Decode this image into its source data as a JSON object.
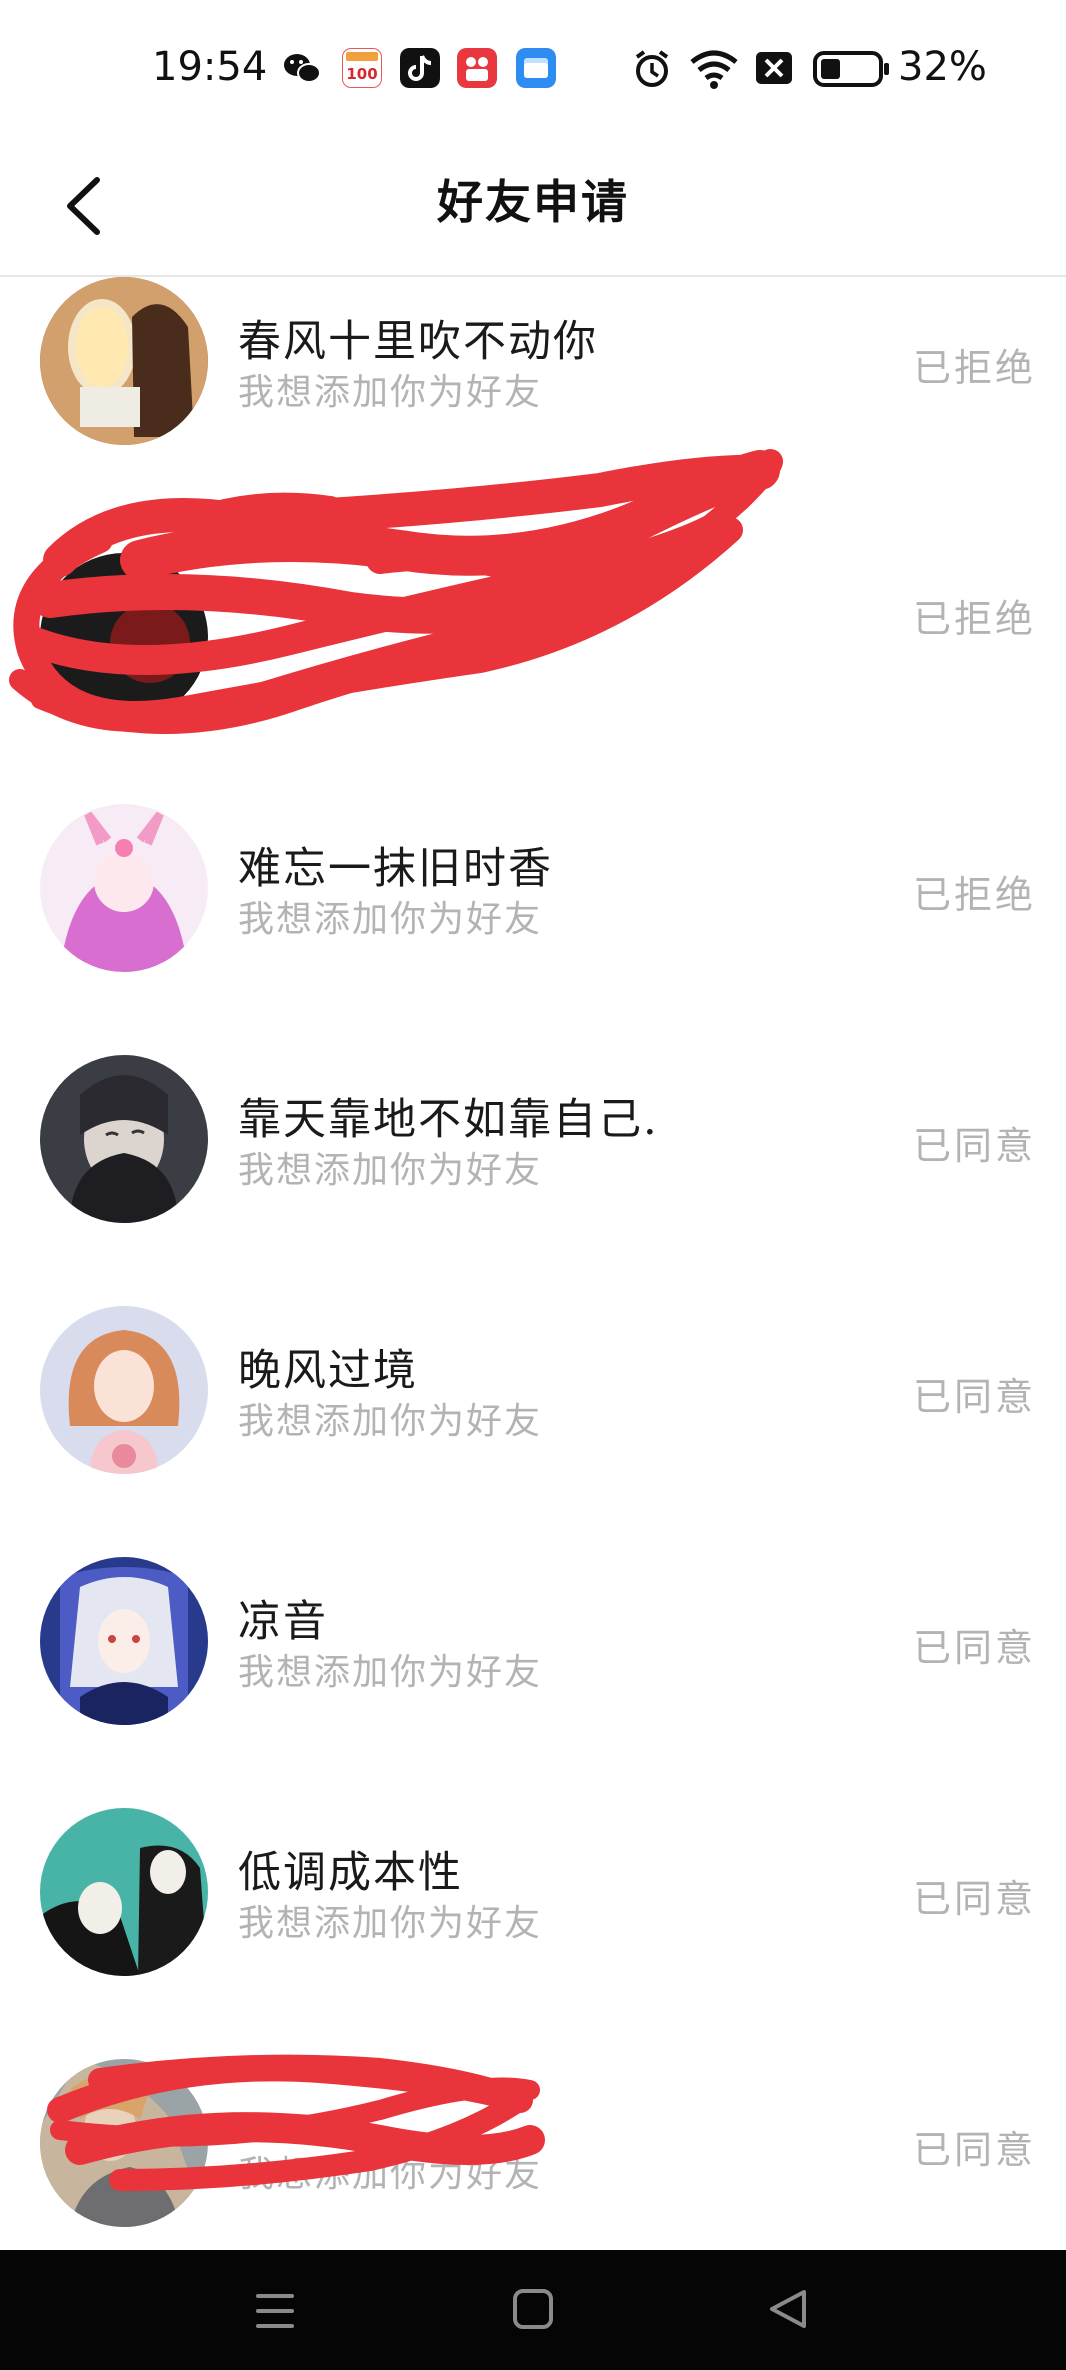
{
  "status_bar": {
    "time": "19:54",
    "battery_percent": "32%",
    "battery_level": 0.32,
    "app_icons": [
      "wechat-icon",
      "xiaoyuan-100-icon",
      "tiktok-icon",
      "kuaishou-icon",
      "files-icon"
    ],
    "system_icons": [
      "alarm-icon",
      "wifi-icon",
      "no-sim-icon",
      "battery-icon"
    ]
  },
  "header": {
    "title": "好友申请",
    "back_icon": "chevron-left-icon"
  },
  "requests": [
    {
      "name": "春风十里吹不动你",
      "message": "我想添加你为好友",
      "status": "已拒绝",
      "avatar_colors": [
        "#d9b38c",
        "#5b3a28"
      ]
    },
    {
      "name": "",
      "message": "",
      "status": "已拒绝",
      "avatar_colors": [
        "#1b1b1b",
        "#7a1a1a"
      ]
    },
    {
      "name": "难忘一抹旧时香",
      "message": "我想添加你为好友",
      "status": "已拒绝",
      "avatar_colors": [
        "#f5d4ec",
        "#c06bc4"
      ]
    },
    {
      "name": "靠天靠地不如靠自己.",
      "message": "我想添加你为好友",
      "status": "已同意",
      "avatar_colors": [
        "#3a3d44",
        "#d9d2cc"
      ]
    },
    {
      "name": "晚风过境",
      "message": "我想添加你为好友",
      "status": "已同意",
      "avatar_colors": [
        "#d9dced",
        "#d98a5a"
      ]
    },
    {
      "name": "凉音",
      "message": "我想添加你为好友",
      "status": "已同意",
      "avatar_colors": [
        "#3a44a8",
        "#e4e6f2"
      ]
    },
    {
      "name": "低调成本性",
      "message": "我想添加你为好友",
      "status": "已同意",
      "avatar_colors": [
        "#48b4a8",
        "#1a1a1a"
      ]
    },
    {
      "name": "",
      "message": "我想添加你为好友",
      "status": "已同意",
      "avatar_colors": [
        "#9aa3a6",
        "#d9a36a"
      ]
    }
  ],
  "system_nav": {
    "icons": [
      "menu-icon",
      "home-icon",
      "back-triangle-icon"
    ]
  },
  "colors": {
    "redaction": "#e8343a",
    "secondary_text": "#b3b3b3",
    "nav_background": "#050505"
  }
}
